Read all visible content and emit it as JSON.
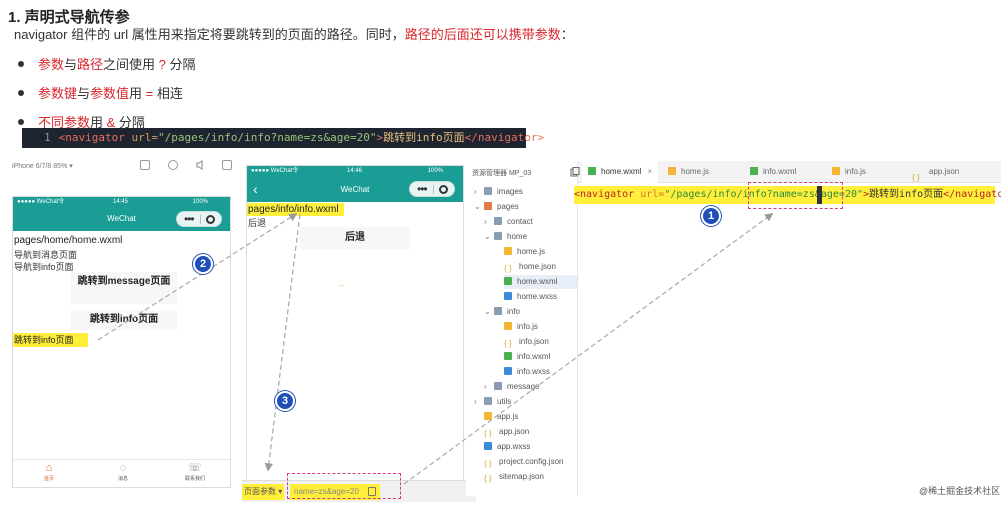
{
  "doc": {
    "title": "1. 声明式导航传参",
    "intro_pre": "navigator 组件的 url 属性用来指定将要跳转到的页面的路径。同时，",
    "intro_red": "路径的后面还可以携带参数",
    "intro_post": "：",
    "bullets": [
      {
        "red1": "参数",
        "mid1": "与",
        "red2": "路径",
        "mid2": "之间使用 ",
        "red3": "?",
        "end": " 分隔"
      },
      {
        "red1": "参数键",
        "mid1": "与",
        "red2": "参数值",
        "mid2": "用 ",
        "red3": "=",
        "end": " 相连"
      },
      {
        "red1": "不同参数",
        "mid1": "用 ",
        "red2": "&",
        "mid2": " 分隔",
        "red3": "",
        "end": ""
      }
    ],
    "code": {
      "line_no": "1",
      "open_tag": "<navigator",
      "attr": " url=",
      "value": "\"/pages/info/info?name=zs&age=20\"",
      "gt": ">",
      "text": "跳转到info页面",
      "close_tag": "</navigator>"
    }
  },
  "simulator": {
    "device_label": "iPhone 6/7/8 85% ▾",
    "phone1": {
      "status_left": "●●●●● WeChat令",
      "status_time": "14:45",
      "status_right": "100%",
      "nav_title": "WeChat",
      "path": "pages/home/home.wxml",
      "line1": "导航到消息页面",
      "line2": "导航到info页面",
      "btn1": "跳转到message页面",
      "btn2": "跳转到info页面",
      "highlight": "跳转到info页面",
      "tabs": [
        {
          "icon": "⌂",
          "label": "首页"
        },
        {
          "icon": "◌",
          "label": "消息"
        },
        {
          "icon": "☏",
          "label": "联系我们"
        }
      ]
    },
    "phone2": {
      "status_left": "●●●●● WeChat令",
      "status_time": "14:46",
      "status_right": "100%",
      "nav_title": "WeChat",
      "back_glyph": "‹",
      "path": "pages/info/info.wxml",
      "back_text": "后退",
      "btn": "后退",
      "dash": "–"
    },
    "params": {
      "label": "页面参数 ▾",
      "value": "name=zs&age=20"
    }
  },
  "explorer": {
    "header": "资源管理器 MP_03",
    "items": [
      {
        "label": "images",
        "indent": 0,
        "icon": "folder",
        "chev": "›"
      },
      {
        "label": "pages",
        "indent": 0,
        "icon": "folder-o",
        "chev": "⌄"
      },
      {
        "label": "contact",
        "indent": 1,
        "icon": "folder",
        "chev": "›"
      },
      {
        "label": "home",
        "indent": 1,
        "icon": "folder",
        "chev": "⌄"
      },
      {
        "label": "home.js",
        "indent": 2,
        "icon": "js",
        "chev": ""
      },
      {
        "label": "home.json",
        "indent": 2,
        "icon": "json",
        "chev": ""
      },
      {
        "label": "home.wxml",
        "indent": 2,
        "icon": "wxml",
        "chev": "",
        "selected": true
      },
      {
        "label": "home.wxss",
        "indent": 2,
        "icon": "wxss",
        "chev": ""
      },
      {
        "label": "info",
        "indent": 1,
        "icon": "folder",
        "chev": "⌄"
      },
      {
        "label": "info.js",
        "indent": 2,
        "icon": "js",
        "chev": ""
      },
      {
        "label": "info.json",
        "indent": 2,
        "icon": "json",
        "chev": ""
      },
      {
        "label": "info.wxml",
        "indent": 2,
        "icon": "wxml",
        "chev": ""
      },
      {
        "label": "info.wxss",
        "indent": 2,
        "icon": "wxss",
        "chev": ""
      },
      {
        "label": "message",
        "indent": 1,
        "icon": "folder",
        "chev": "›"
      },
      {
        "label": "utils",
        "indent": 0,
        "icon": "folder",
        "chev": "›"
      },
      {
        "label": "app.js",
        "indent": 0,
        "icon": "js",
        "chev": ""
      },
      {
        "label": "app.json",
        "indent": 0,
        "icon": "json",
        "chev": ""
      },
      {
        "label": "app.wxss",
        "indent": 0,
        "icon": "wxss",
        "chev": ""
      },
      {
        "label": "project.config.json",
        "indent": 0,
        "icon": "json",
        "chev": ""
      },
      {
        "label": "sitemap.json",
        "indent": 0,
        "icon": "json",
        "chev": ""
      }
    ]
  },
  "editor": {
    "tabs": [
      {
        "label": "home.wxml",
        "icon": "wxml",
        "active": true,
        "close": "×"
      },
      {
        "label": "home.js",
        "icon": "js",
        "active": false
      },
      {
        "label": "info.wxml",
        "icon": "wxml",
        "active": false
      },
      {
        "label": "info.js",
        "icon": "js",
        "active": false
      },
      {
        "label": "app.json",
        "icon": "json",
        "active": false
      }
    ],
    "code": {
      "open_tag": "<navigator",
      "attr": " url=",
      "value": "\"/pages/info/info?name=zs&age=20\"",
      "gt": ">",
      "text": "跳转到info页面",
      "close_tag": "</navigator>"
    }
  },
  "badges": [
    "1",
    "2",
    "3"
  ],
  "watermark": "@稀土掘金技术社区",
  "colors": {
    "highlight": "#ffef3a",
    "wechat_teal": "#1a9d95",
    "badge_blue": "#1f4fb8",
    "dash_pink": "#d23a8a",
    "emphasis_red": "#d8262a"
  }
}
